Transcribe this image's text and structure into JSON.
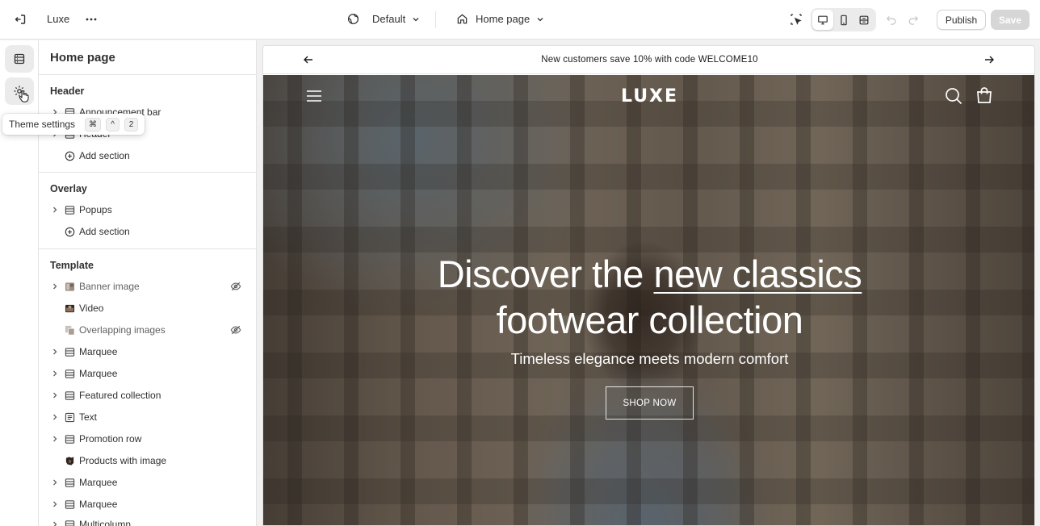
{
  "topbar": {
    "store_name": "Luxe",
    "theme_name": "Default",
    "page_selector": "Home page",
    "publish_label": "Publish",
    "save_label": "Save"
  },
  "sidebar": {
    "title": "Home page",
    "groups": [
      {
        "title": "Header",
        "items": [
          {
            "label": "Announcement bar",
            "icon": "section-icon",
            "expandable": true
          },
          {
            "label": "Header",
            "icon": "section-icon",
            "expandable": true
          }
        ],
        "add_label": "Add section"
      },
      {
        "title": "Overlay",
        "items": [
          {
            "label": "Popups",
            "icon": "section-icon",
            "expandable": true
          }
        ],
        "add_label": "Add section"
      },
      {
        "title": "Template",
        "items": [
          {
            "label": "Banner image",
            "icon": "image-icon",
            "expandable": true,
            "hidden": true
          },
          {
            "label": "Video",
            "icon": "video-thumb-icon",
            "expandable": false
          },
          {
            "label": "Overlapping images",
            "icon": "image-icon",
            "expandable": false,
            "hidden": true
          },
          {
            "label": "Marquee",
            "icon": "section-icon",
            "expandable": true
          },
          {
            "label": "Marquee",
            "icon": "section-icon",
            "expandable": true
          },
          {
            "label": "Featured collection",
            "icon": "section-icon",
            "expandable": true
          },
          {
            "label": "Text",
            "icon": "text-icon",
            "expandable": true
          },
          {
            "label": "Promotion row",
            "icon": "section-icon",
            "expandable": true
          },
          {
            "label": "Products with image",
            "icon": "product-thumb-icon",
            "expandable": false
          },
          {
            "label": "Marquee",
            "icon": "section-icon",
            "expandable": true
          },
          {
            "label": "Marquee",
            "icon": "section-icon",
            "expandable": true
          },
          {
            "label": "Multicolumn",
            "icon": "section-icon",
            "expandable": true
          }
        ]
      }
    ]
  },
  "tooltip": {
    "label": "Theme settings",
    "keys": [
      "⌘",
      "^",
      "2"
    ]
  },
  "preview": {
    "announcement": "New customers save 10% with code WELCOME10",
    "logo": "LUXE",
    "hero_title_part1": "Discover the ",
    "hero_title_underlined": "new classics",
    "hero_title_line2": "footwear collection",
    "hero_subtitle": "Timeless elegance meets modern comfort",
    "cta_label": "SHOP NOW"
  },
  "colors": {
    "accent": "#303030",
    "save_disabled": "#d6d6d6",
    "rail_active": "#ebebeb"
  }
}
